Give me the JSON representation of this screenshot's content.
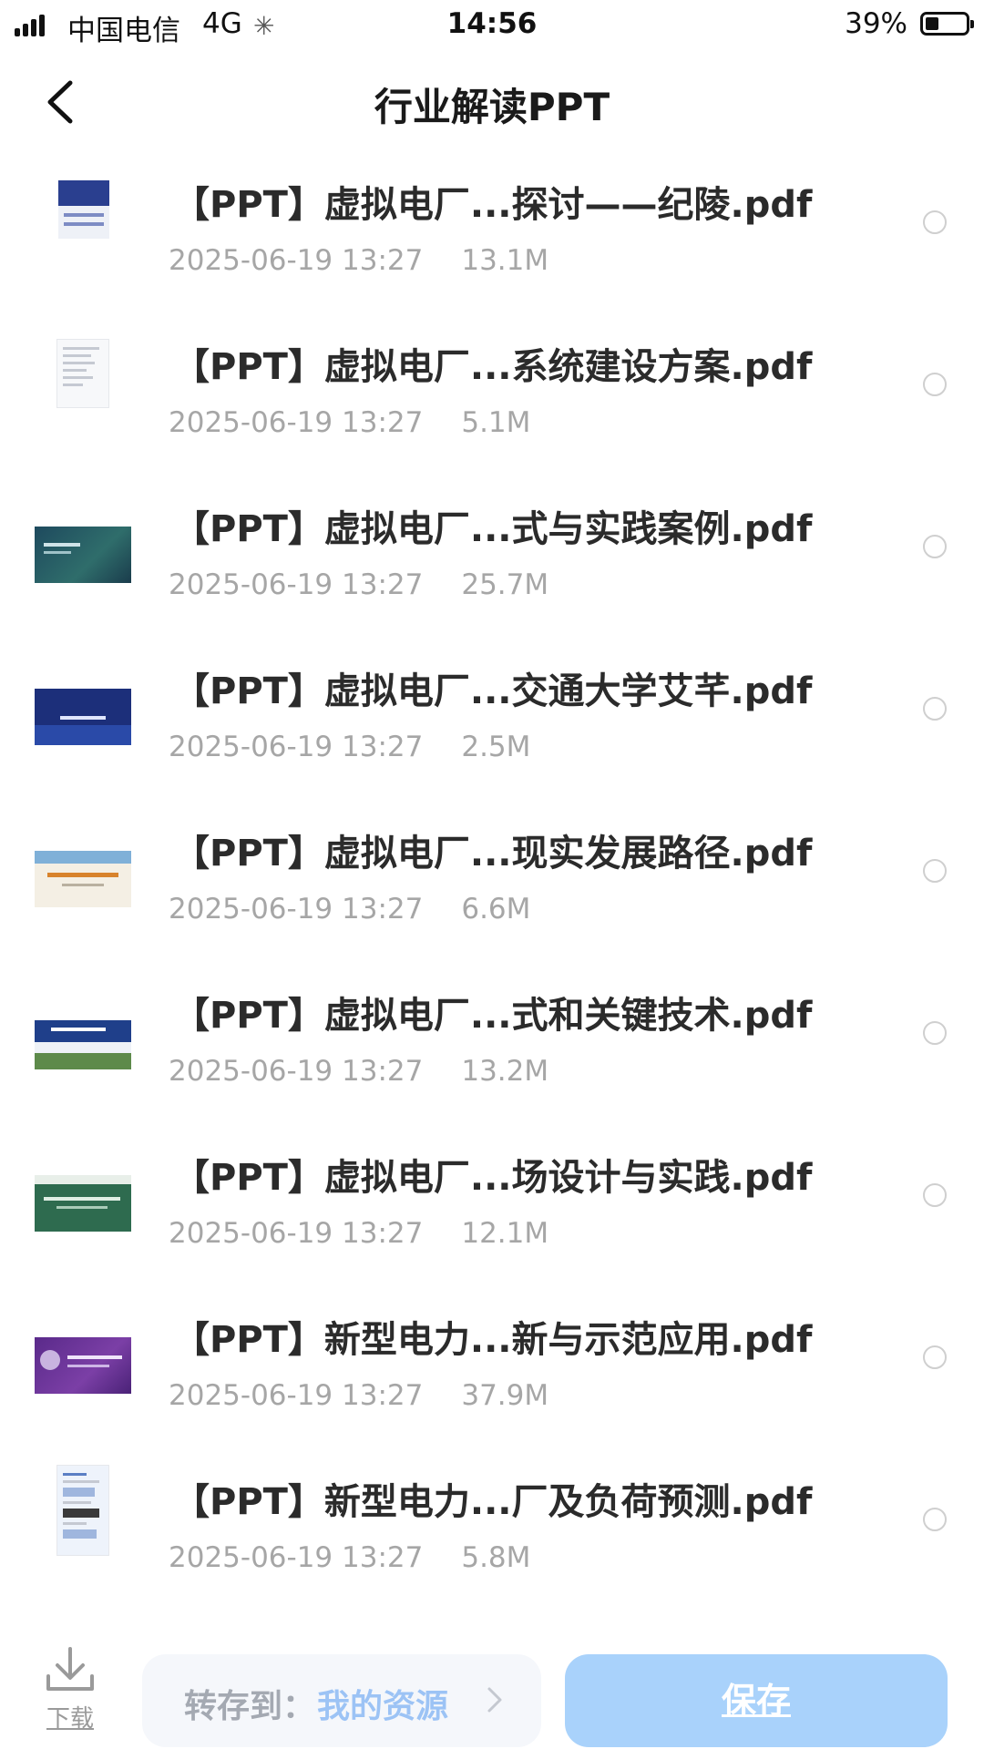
{
  "status_bar": {
    "carrier": "中国电信",
    "network": "4G",
    "time": "14:56",
    "battery": "39%",
    "battery_level": 0.39
  },
  "header": {
    "back_icon": "chevron-left-icon",
    "title": "行业解读PPT"
  },
  "files": [
    {
      "name": "【PPT】虚拟电厂...探讨——纪陵.pdf",
      "date": "2025-06-19 13:27",
      "size": "13.1M",
      "selected": false
    },
    {
      "name": "【PPT】虚拟电厂...系统建设方案.pdf",
      "date": "2025-06-19 13:27",
      "size": "5.1M",
      "selected": false
    },
    {
      "name": "【PPT】虚拟电厂...式与实践案例.pdf",
      "date": "2025-06-19 13:27",
      "size": "25.7M",
      "selected": false
    },
    {
      "name": "【PPT】虚拟电厂...交通大学艾芊.pdf",
      "date": "2025-06-19 13:27",
      "size": "2.5M",
      "selected": false
    },
    {
      "name": "【PPT】虚拟电厂...现实发展路径.pdf",
      "date": "2025-06-19 13:27",
      "size": "6.6M",
      "selected": false
    },
    {
      "name": "【PPT】虚拟电厂...式和关键技术.pdf",
      "date": "2025-06-19 13:27",
      "size": "13.2M",
      "selected": false
    },
    {
      "name": "【PPT】虚拟电厂...场设计与实践.pdf",
      "date": "2025-06-19 13:27",
      "size": "12.1M",
      "selected": false
    },
    {
      "name": "【PPT】新型电力...新与示范应用.pdf",
      "date": "2025-06-19 13:27",
      "size": "37.9M",
      "selected": false
    },
    {
      "name": "【PPT】新型电力...厂及负荷预测.pdf",
      "date": "2025-06-19 13:27",
      "size": "5.8M",
      "selected": false
    }
  ],
  "bottom_bar": {
    "download_label": "下载",
    "save_to_label": "转存到：",
    "save_to_value": "我的资源",
    "save_label": "保存"
  },
  "colors": {
    "accent": "#5b9ef0",
    "save_button_bg": "#a9d2fb",
    "meta_text": "#a6a6a6"
  }
}
